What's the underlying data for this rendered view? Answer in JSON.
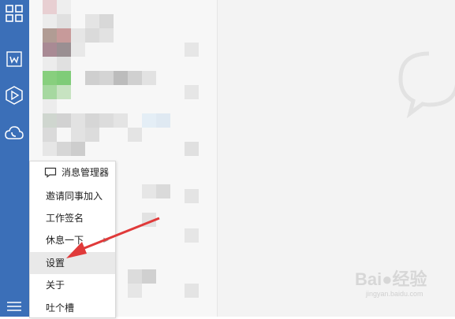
{
  "menu": {
    "items": [
      {
        "label": "消息管理器",
        "icon": "message-manager-icon"
      },
      {
        "label": "邀请同事加入"
      },
      {
        "label": "工作签名"
      },
      {
        "label": "休息一下",
        "has_submenu": true
      },
      {
        "label": "设置",
        "highlighted": true
      },
      {
        "label": "关于"
      },
      {
        "label": "吐个槽"
      }
    ]
  },
  "rail_icons": [
    "apps-grid-icon",
    "document-w-icon",
    "hexagon-play-icon",
    "cloud-phone-icon",
    "hamburger-menu-icon"
  ],
  "watermark": {
    "brand": "Bai",
    "brand2": "经验",
    "sub": "jingyan.baidu.com"
  },
  "colors": {
    "rail": "#3b6fb8",
    "arrow": "#e03a3a",
    "highlight": "#e9e9e9"
  }
}
